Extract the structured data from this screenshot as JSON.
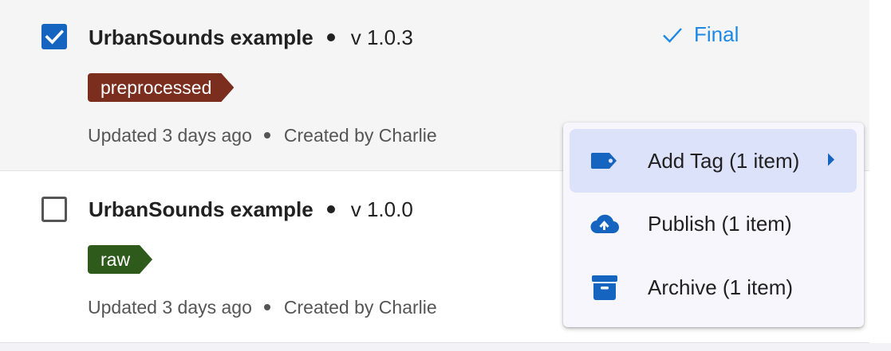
{
  "rows": [
    {
      "title": "UrbanSounds example",
      "version": "v 1.0.3",
      "checked": true,
      "tag": {
        "label": "preprocessed",
        "color": "#7b2d1e"
      },
      "updated": "Updated 3 days ago",
      "created": "Created by Charlie",
      "status": {
        "label": "Final",
        "icon": "check-icon",
        "color": "#1e88e5"
      }
    },
    {
      "title": "UrbanSounds example",
      "version": "v 1.0.0",
      "checked": false,
      "tag": {
        "label": "raw",
        "color": "#2e5a1c"
      },
      "updated": "Updated 3 days ago",
      "created": "Created by Charlie"
    }
  ],
  "context_menu": {
    "items": [
      {
        "label": "Add Tag (1 item)",
        "icon": "tag-icon",
        "has_submenu": true,
        "highlighted": true
      },
      {
        "label": "Publish (1 item)",
        "icon": "cloud-upload-icon",
        "has_submenu": false,
        "highlighted": false
      },
      {
        "label": "Archive (1 item)",
        "icon": "archive-icon",
        "has_submenu": false,
        "highlighted": false
      }
    ]
  },
  "colors": {
    "accent": "#1565c0",
    "selected_row_bg": "#f5f5f5",
    "menu_highlight": "#dce2fa"
  }
}
